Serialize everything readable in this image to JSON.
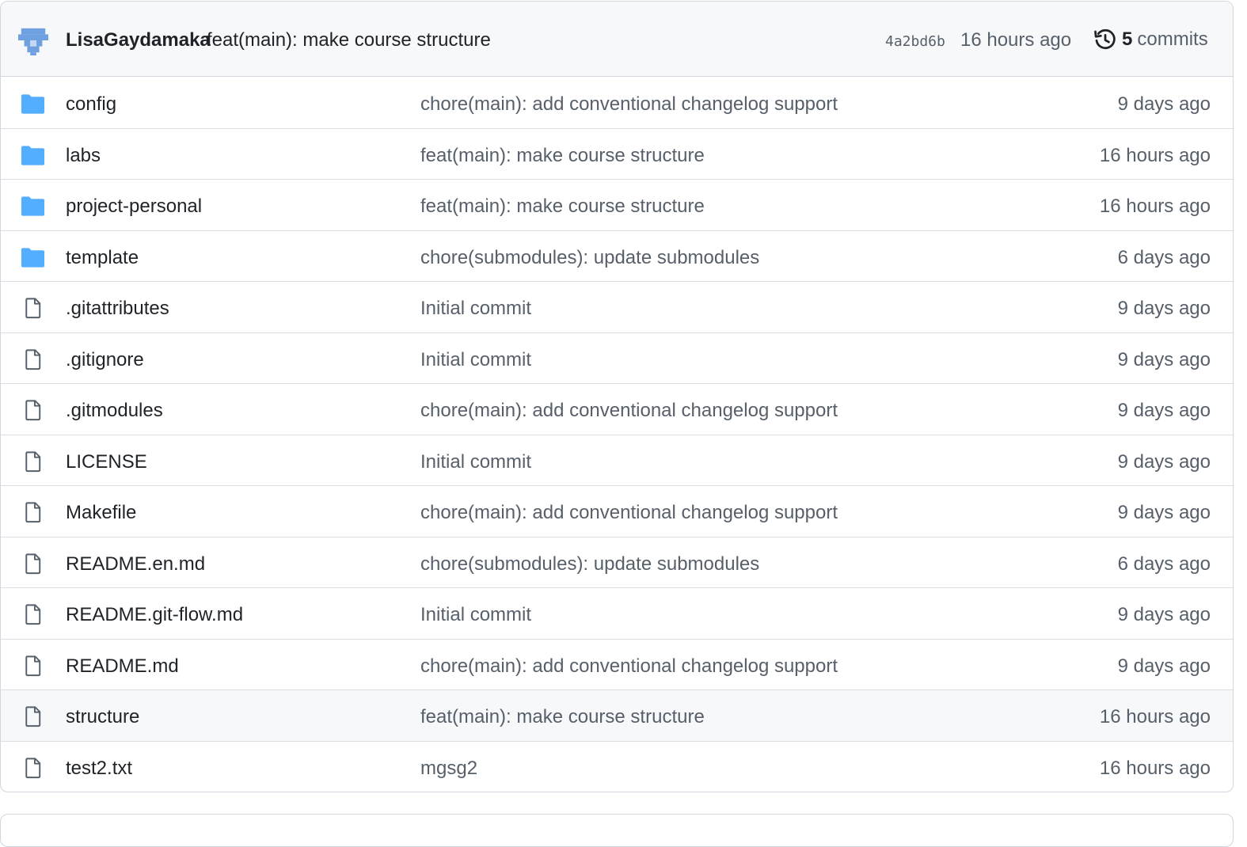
{
  "latest_commit": {
    "author": "LisaGaydamaka",
    "message": "feat(main): make course structure",
    "hash": "4a2bd6b",
    "time": "16 hours ago",
    "commits_count": "5",
    "commits_label": "commits",
    "avatar_icon": "identicon-avatar",
    "history_icon": "history-icon"
  },
  "files": [
    {
      "type": "folder",
      "icon": "folder-icon",
      "name": "config",
      "message": "chore(main): add conventional changelog support",
      "age": "9 days ago"
    },
    {
      "type": "folder",
      "icon": "folder-icon",
      "name": "labs",
      "message": "feat(main): make course structure",
      "age": "16 hours ago"
    },
    {
      "type": "folder",
      "icon": "folder-icon",
      "name": "project-personal",
      "message": "feat(main): make course structure",
      "age": "16 hours ago"
    },
    {
      "type": "folder",
      "icon": "folder-icon",
      "name": "template",
      "message": "chore(submodules): update submodules",
      "age": "6 days ago"
    },
    {
      "type": "file",
      "icon": "file-icon",
      "name": ".gitattributes",
      "message": "Initial commit",
      "age": "9 days ago"
    },
    {
      "type": "file",
      "icon": "file-icon",
      "name": ".gitignore",
      "message": "Initial commit",
      "age": "9 days ago"
    },
    {
      "type": "file",
      "icon": "file-icon",
      "name": ".gitmodules",
      "message": "chore(main): add conventional changelog support",
      "age": "9 days ago"
    },
    {
      "type": "file",
      "icon": "file-icon",
      "name": "LICENSE",
      "message": "Initial commit",
      "age": "9 days ago"
    },
    {
      "type": "file",
      "icon": "file-icon",
      "name": "Makefile",
      "message": "chore(main): add conventional changelog support",
      "age": "9 days ago"
    },
    {
      "type": "file",
      "icon": "file-icon",
      "name": "README.en.md",
      "message": "chore(submodules): update submodules",
      "age": "6 days ago"
    },
    {
      "type": "file",
      "icon": "file-icon",
      "name": "README.git-flow.md",
      "message": "Initial commit",
      "age": "9 days ago"
    },
    {
      "type": "file",
      "icon": "file-icon",
      "name": "README.md",
      "message": "chore(main): add conventional changelog support",
      "age": "9 days ago"
    },
    {
      "type": "file",
      "icon": "file-icon",
      "name": "structure",
      "message": "feat(main): make course structure",
      "age": "16 hours ago",
      "hovered": true
    },
    {
      "type": "file",
      "icon": "file-icon",
      "name": "test2.txt",
      "message": "mgsg2",
      "age": "16 hours ago"
    }
  ],
  "colors": {
    "folder": "#54aeff",
    "file_icon": "#57606a",
    "header_bg": "#f6f8fa",
    "border": "#d0d7de",
    "muted_text": "#57606a",
    "primary_text": "#1f2328"
  }
}
